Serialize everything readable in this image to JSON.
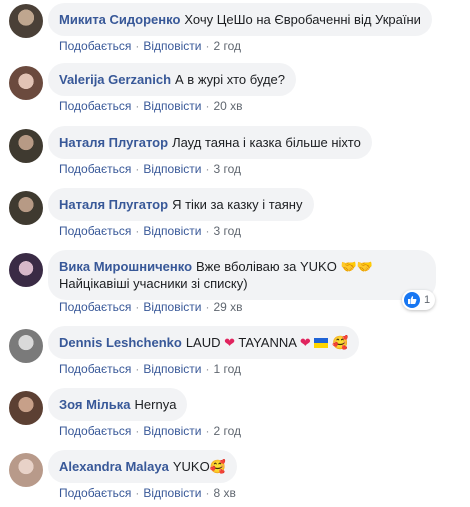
{
  "comments": [
    {
      "name": "Микита Сидоренко",
      "text": "Хочу ЦеШо на Євробаченні від України",
      "time": "2 год"
    },
    {
      "name": "Valerija Gerzanich",
      "text": "А в журі хто буде?",
      "time": "20 хв"
    },
    {
      "name": "Наталя Плугатор",
      "text": "Лауд таяна і казка більше ніхто",
      "time": "3 год"
    },
    {
      "name": "Наталя Плугатор",
      "text": "Я тіки за казку і таяну",
      "time": "3 год"
    },
    {
      "name": "Вика Мирошниченко",
      "text": "Вже вболіваю за YUKO",
      "text2": "Найцікавіші учасники зі списку)",
      "time": "29 хв"
    },
    {
      "name": "Dennis Leshchenko",
      "text": "LAUD",
      "text_b": "TAYANNA",
      "time": "1 год"
    },
    {
      "name": "Зоя Мілька",
      "text": "Hernya",
      "time": "2 год"
    },
    {
      "name": "Alexandra Malaya",
      "text": "YUKO",
      "time": "8 хв"
    }
  ],
  "actions": {
    "like": "Подобається",
    "reply": "Відповісти",
    "dot": "·"
  },
  "reaction": {
    "count": "1",
    "icon": "like-icon"
  },
  "colors": {
    "name": "#385898",
    "bubble": "#f2f3f5",
    "meta": "#606770",
    "like": "#1877f2"
  }
}
